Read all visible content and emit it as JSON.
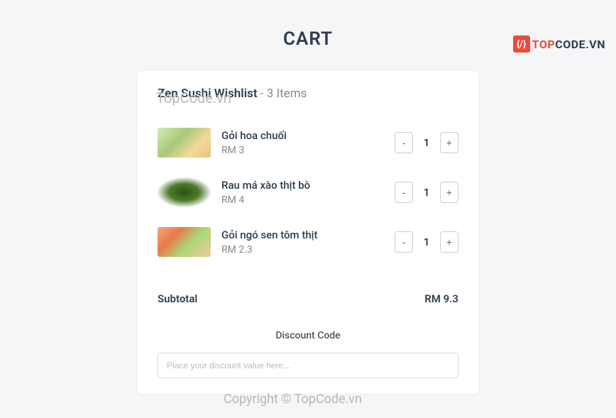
{
  "logo": {
    "icon_text": "{/}",
    "text_top": "TOP",
    "text_code": "CODE.VN"
  },
  "watermarks": {
    "wm1": "TopCode.vn",
    "wm2": "Copyright © TopCode.vn"
  },
  "page": {
    "title": "CART"
  },
  "cart": {
    "header_title": "Zen Sushi Wishlist",
    "header_separator": " - ",
    "header_count": "3 Items",
    "items": [
      {
        "name": "Gỏi hoa chuối",
        "price": "RM 3",
        "qty": "1",
        "minus": "-",
        "plus": "+"
      },
      {
        "name": "Rau má xào thịt bò",
        "price": "RM 4",
        "qty": "1",
        "minus": "-",
        "plus": "+"
      },
      {
        "name": "Gỏi ngó sen tôm thịt",
        "price": "RM 2.3",
        "qty": "1",
        "minus": "-",
        "plus": "+"
      }
    ],
    "subtotal_label": "Subtotal",
    "subtotal_value": "RM 9.3",
    "discount_title": "Discount Code",
    "discount_placeholder": "Place your discount value here..."
  }
}
